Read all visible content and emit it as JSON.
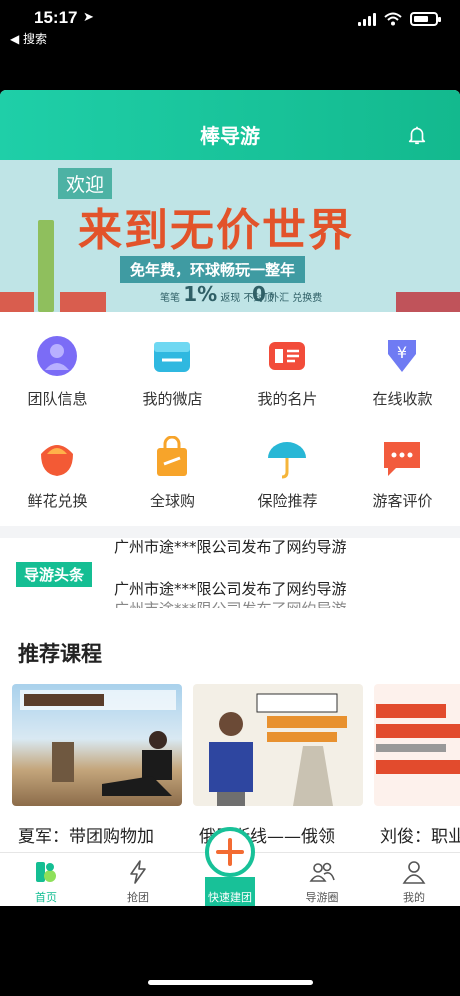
{
  "status_bar": {
    "time": "15:17",
    "location_arrow": "➤",
    "back_label": "◀ 搜索"
  },
  "header": {
    "title": "棒导游",
    "bell_icon": "bell-icon"
  },
  "banner": {
    "welcome": "欢迎",
    "headline": "来到无价世界",
    "subline": "免年费，环球畅玩一整年",
    "stat1_prefix": "笔笔",
    "stat1_value": "1%",
    "stat1_suffix": "返现 不封顶",
    "stat2_value": "0",
    "stat2_suffix": "外汇 兑换费"
  },
  "grid": [
    {
      "label": "团队信息",
      "icon": "team-icon",
      "color": "#7b6cf6"
    },
    {
      "label": "我的微店",
      "icon": "store-icon",
      "color": "#2fb8e0"
    },
    {
      "label": "我的名片",
      "icon": "card-icon",
      "color": "#f24c3a"
    },
    {
      "label": "在线收款",
      "icon": "yuan-icon",
      "color": "#6f7bf3"
    },
    {
      "label": "鲜花兑换",
      "icon": "flower-icon",
      "color": "#f35a35"
    },
    {
      "label": "全球购",
      "icon": "bag-icon",
      "color": "#f7a42a"
    },
    {
      "label": "保险推荐",
      "icon": "umbrella-icon",
      "color": "#28b7d6"
    },
    {
      "label": "游客评价",
      "icon": "chat-icon",
      "color": "#f25b3d"
    }
  ],
  "news": {
    "tag": "导游头条",
    "lines": [
      "广州市途***限公司发布了网约导游",
      "广州市途***限公司发布了网约导游",
      "广州市途***限公司发布了网约导游"
    ]
  },
  "courses": {
    "heading": "推荐课程",
    "cards": [
      {
        "title": "夏军：带团购物加"
      },
      {
        "title": "俄罗斯线——俄领"
      },
      {
        "title": "刘俊：职业"
      }
    ]
  },
  "tabbar": {
    "tabs": [
      {
        "label": "首页",
        "icon": "home-icon"
      },
      {
        "label": "抢团",
        "icon": "lightning-icon"
      },
      {
        "label": "快速建团",
        "icon": "plus-icon"
      },
      {
        "label": "导游圈",
        "icon": "people-icon"
      },
      {
        "label": "我的",
        "icon": "person-icon"
      }
    ]
  },
  "colors": {
    "brand": "#15be93",
    "accent_orange": "#f36b32"
  }
}
